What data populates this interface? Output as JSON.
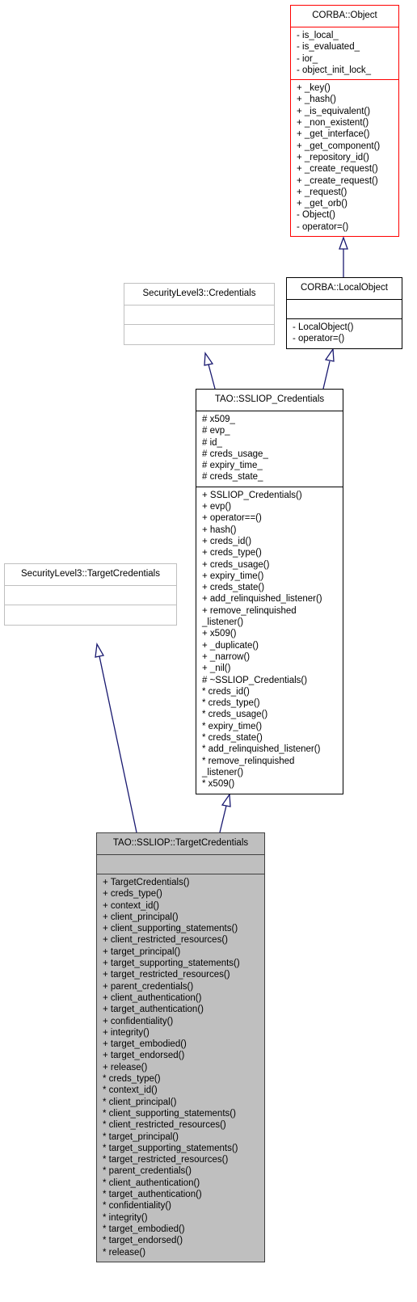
{
  "diagram": {
    "type": "class-inheritance",
    "classes": {
      "corba_object": {
        "name": "CORBA::Object",
        "attributes": [
          "- is_local_",
          "- is_evaluated_",
          "- ior_",
          "- object_init_lock_"
        ],
        "methods": [
          "+ _key()",
          "+ _hash()",
          "+ _is_equivalent()",
          "+ _non_existent()",
          "+ _get_interface()",
          "+ _get_component()",
          "+ _repository_id()",
          "+ _create_request()",
          "+ _create_request()",
          "+ _request()",
          "+ _get_orb()",
          "- Object()",
          "- operator=()"
        ]
      },
      "corba_localobject": {
        "name": "CORBA::LocalObject",
        "attributes": [],
        "methods": [
          "- LocalObject()",
          "- operator=()"
        ]
      },
      "sl3_credentials": {
        "name": "SecurityLevel3::Credentials",
        "attributes": [],
        "methods": []
      },
      "ssliop_credentials": {
        "name": "TAO::SSLIOP_Credentials",
        "attributes": [
          "# x509_",
          "# evp_",
          "# id_",
          "# creds_usage_",
          "# expiry_time_",
          "# creds_state_"
        ],
        "methods": [
          "+ SSLIOP_Credentials()",
          "+ evp()",
          "+ operator==()",
          "+ hash()",
          "+ creds_id()",
          "+ creds_type()",
          "+ creds_usage()",
          "+ expiry_time()",
          "+ creds_state()",
          "+ add_relinquished_listener()",
          "+ remove_relinquished",
          "_listener()",
          "+ x509()",
          "+ _duplicate()",
          "+ _narrow()",
          "+ _nil()",
          "# ~SSLIOP_Credentials()",
          "* creds_id()",
          "* creds_type()",
          "* creds_usage()",
          "* expiry_time()",
          "* creds_state()",
          "* add_relinquished_listener()",
          "* remove_relinquished",
          "_listener()",
          "* x509()"
        ]
      },
      "sl3_targetcredentials": {
        "name": "SecurityLevel3::TargetCredentials",
        "attributes": [],
        "methods": []
      },
      "ssliop_targetcredentials": {
        "name": "TAO::SSLIOP::TargetCredentials",
        "attributes": [],
        "methods": [
          "+ TargetCredentials()",
          "+ creds_type()",
          "+ context_id()",
          "+ client_principal()",
          "+ client_supporting_statements()",
          "+ client_restricted_resources()",
          "+ target_principal()",
          "+ target_supporting_statements()",
          "+ target_restricted_resources()",
          "+ parent_credentials()",
          "+ client_authentication()",
          "+ target_authentication()",
          "+ confidentiality()",
          "+ integrity()",
          "+ target_embodied()",
          "+ target_endorsed()",
          "+ release()",
          "* creds_type()",
          "* context_id()",
          "* client_principal()",
          "* client_supporting_statements()",
          "* client_restricted_resources()",
          "* target_principal()",
          "* target_supporting_statements()",
          "* target_restricted_resources()",
          "* parent_credentials()",
          "* client_authentication()",
          "* target_authentication()",
          "* confidentiality()",
          "* integrity()",
          "* target_embodied()",
          "* target_endorsed()",
          "* release()"
        ]
      }
    },
    "inheritance": [
      {
        "child": "CORBA::LocalObject",
        "parent": "CORBA::Object"
      },
      {
        "child": "TAO::SSLIOP_Credentials",
        "parent": "SecurityLevel3::Credentials"
      },
      {
        "child": "TAO::SSLIOP_Credentials",
        "parent": "CORBA::LocalObject"
      },
      {
        "child": "TAO::SSLIOP::TargetCredentials",
        "parent": "SecurityLevel3::TargetCredentials"
      },
      {
        "child": "TAO::SSLIOP::TargetCredentials",
        "parent": "TAO::SSLIOP_Credentials"
      }
    ],
    "colors": {
      "edge": "#191970",
      "undocumented_border": "#ff0000",
      "external_border": "#bfbfbf",
      "focus_fill": "#bfbfbf"
    }
  }
}
